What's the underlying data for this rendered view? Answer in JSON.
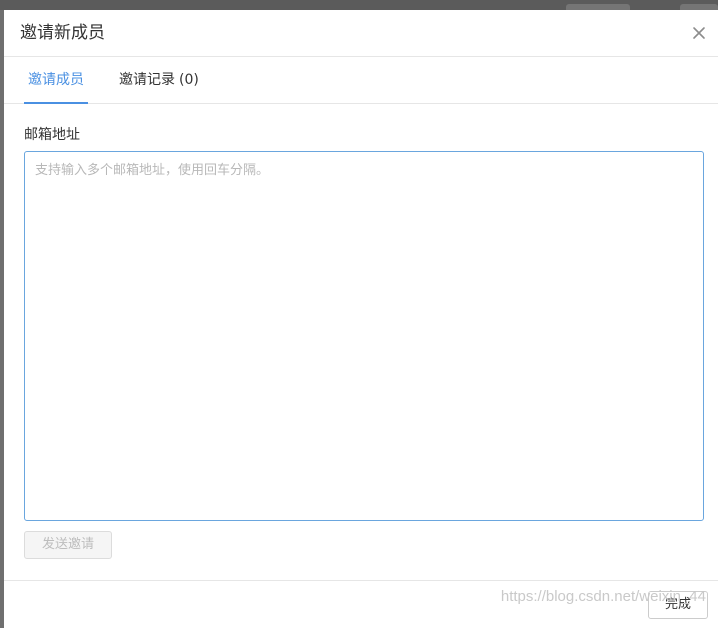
{
  "dialog": {
    "title": "邀请新成员",
    "close_icon": "close-icon"
  },
  "tabs": [
    {
      "label": "邀请成员",
      "active": true
    },
    {
      "label": "邀请记录",
      "count": "(0)",
      "active": false
    }
  ],
  "form": {
    "email_label": "邮箱地址",
    "email_value": "",
    "email_placeholder": "支持输入多个邮箱地址，使用回车分隔。",
    "send_label": "发送邀请",
    "send_disabled": true
  },
  "footer": {
    "done_label": "完成"
  },
  "watermark": {
    "text": "https://blog.csdn.net/weixin_44"
  },
  "colors": {
    "accent": "#4a90e2",
    "input_border": "#6aa6de",
    "overlay": "#6f6f6f"
  }
}
